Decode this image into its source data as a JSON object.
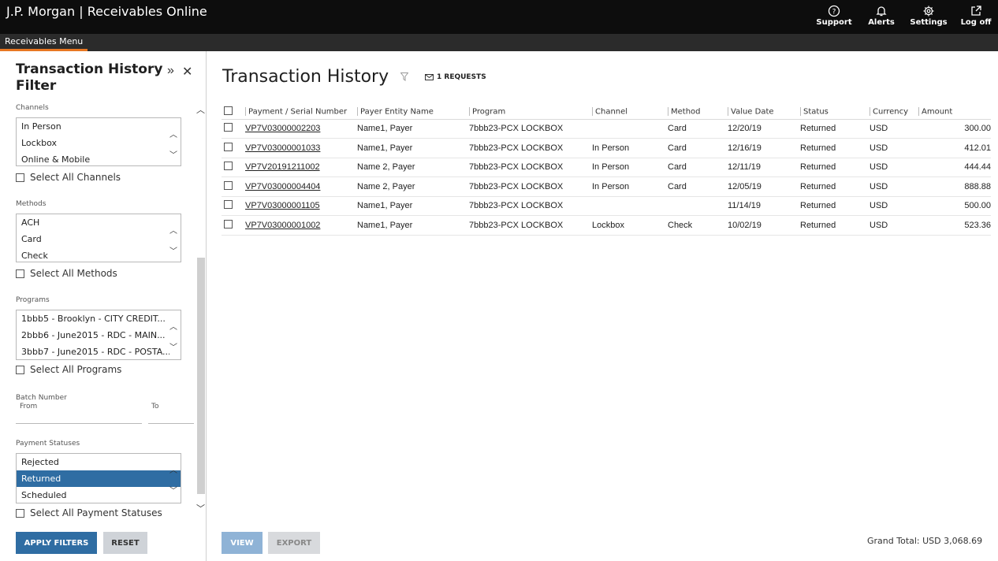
{
  "app": {
    "title": "J.P. Morgan | Receivables Online"
  },
  "topnav": [
    {
      "label": "Support",
      "icon": "support-icon"
    },
    {
      "label": "Alerts",
      "icon": "bell-icon"
    },
    {
      "label": "Settings",
      "icon": "gear-icon"
    },
    {
      "label": "Log off",
      "icon": "logoff-icon"
    }
  ],
  "menubar": {
    "tab": "Receivables Menu"
  },
  "sidebar": {
    "title": "Transaction History Filter",
    "channels": {
      "label": "Channels",
      "options": [
        "In Person",
        "Lockbox",
        "Online & Mobile"
      ],
      "select_all": "Select All Channels"
    },
    "methods": {
      "label": "Methods",
      "options": [
        "ACH",
        "Card",
        "Check"
      ],
      "select_all": "Select All Methods"
    },
    "programs": {
      "label": "Programs",
      "options": [
        "1bbb5 - Brooklyn - CITY CREDIT...",
        "2bbb6 - June2015 - RDC - MAIN...",
        "3bbb7 - June2015 - RDC - POSTA..."
      ],
      "select_all": "Select All Programs"
    },
    "batch": {
      "label": "Batch Number",
      "from": "From",
      "to": "To"
    },
    "statuses": {
      "label": "Payment Statuses",
      "options": [
        "Rejected",
        "Returned",
        "Scheduled"
      ],
      "selected": "Returned",
      "select_all": "Select All Payment Statuses"
    },
    "apply_label": "APPLY FILTERS",
    "reset_label": "RESET"
  },
  "main": {
    "title": "Transaction History",
    "requests": "1 REQUESTS",
    "columns": [
      "Payment / Serial Number",
      "Payer Entity Name",
      "Program",
      "Channel",
      "Method",
      "Value Date",
      "Status",
      "Currency",
      "Amount"
    ],
    "rows": [
      [
        "VP7V03000002203",
        "Name1, Payer",
        "7bbb23-PCX LOCKBOX",
        "",
        "Card",
        "12/20/19",
        "Returned",
        "USD",
        "300.00"
      ],
      [
        "VP7V03000001033",
        "Name1, Payer",
        "7bbb23-PCX LOCKBOX",
        "In Person",
        "Card",
        "12/16/19",
        "Returned",
        "USD",
        "412.01"
      ],
      [
        "VP7V20191211002",
        "Name 2, Payer",
        "7bbb23-PCX LOCKBOX",
        "In Person",
        "Card",
        "12/11/19",
        "Returned",
        "USD",
        "444.44"
      ],
      [
        "VP7V03000004404",
        "Name 2, Payer",
        "7bbb23-PCX LOCKBOX",
        "In Person",
        "Card",
        "12/05/19",
        "Returned",
        "USD",
        "888.88"
      ],
      [
        "VP7V03000001105",
        "Name1, Payer",
        "7bbb23-PCX LOCKBOX",
        "",
        "",
        "11/14/19",
        "Returned",
        "USD",
        "500.00"
      ],
      [
        "VP7V03000001002",
        "Name1, Payer",
        "7bbb23-PCX LOCKBOX",
        "Lockbox",
        "Check",
        "10/02/19",
        "Returned",
        "USD",
        "523.36"
      ]
    ],
    "view_label": "VIEW",
    "export_label": "EXPORT",
    "grand_total": "Grand Total:  USD 3,068.69"
  }
}
